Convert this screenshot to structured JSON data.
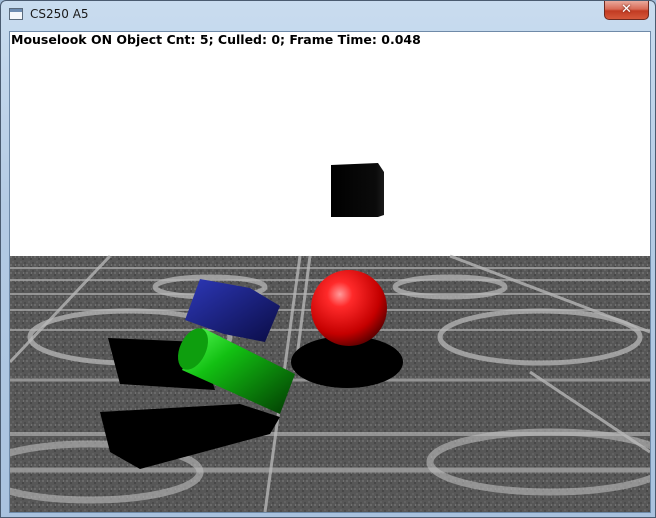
{
  "window": {
    "title": "CS250 A5",
    "close_icon": "close-icon"
  },
  "hud": {
    "status_text": "Mouselook ON Object Cnt: 5; Culled: 0; Frame Time: 0.048"
  },
  "scene": {
    "sky_color": "#ffffff",
    "floor_color": "#5a5a5a",
    "objects": [
      {
        "name": "black-cube",
        "color": "#000000"
      },
      {
        "name": "blue-box",
        "color": "#1a1f8a"
      },
      {
        "name": "green-cylinder",
        "color": "#0a9a14"
      },
      {
        "name": "red-sphere",
        "color": "#d00000"
      },
      {
        "name": "black-slab",
        "color": "#000000"
      }
    ]
  }
}
